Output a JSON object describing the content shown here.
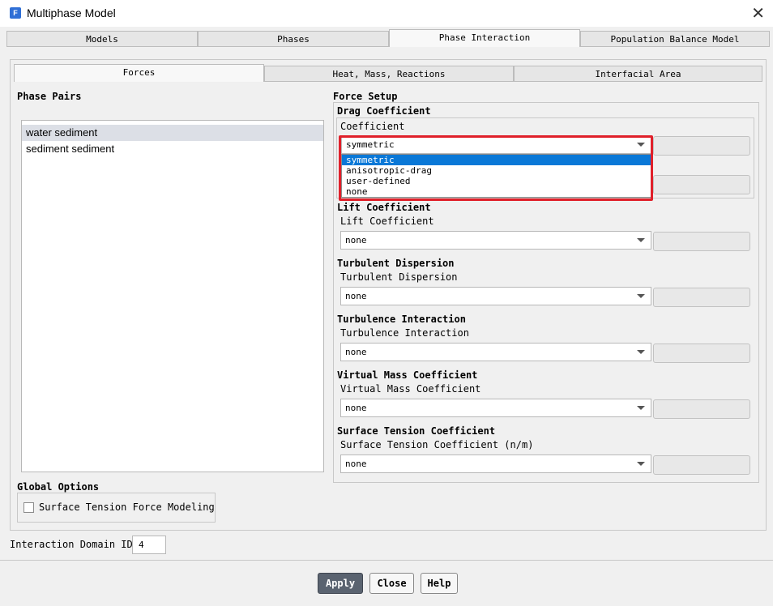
{
  "window": {
    "title": "Multiphase Model",
    "app_icon_letter": "F"
  },
  "top_tabs": [
    {
      "label": "Models"
    },
    {
      "label": "Phases"
    },
    {
      "label": "Phase Interaction"
    },
    {
      "label": "Population Balance Model"
    }
  ],
  "sub_tabs": [
    {
      "label": "Forces"
    },
    {
      "label": "Heat, Mass, Reactions"
    },
    {
      "label": "Interfacial Area"
    }
  ],
  "phase_pairs": {
    "title": "Phase Pairs",
    "items": [
      "water sediment",
      "sediment sediment"
    ],
    "selected": "water sediment"
  },
  "force_setup": {
    "title": "Force Setup",
    "drag": {
      "title": "Drag Coefficient",
      "label": "Coefficient",
      "value": "symmetric",
      "options": [
        "symmetric",
        "anisotropic-drag",
        "user-defined",
        "none"
      ],
      "highlighted": "symmetric"
    },
    "lift": {
      "title": "Lift Coefficient",
      "label": "Lift Coefficient",
      "value": "none"
    },
    "turbulent_dispersion": {
      "title": "Turbulent Dispersion",
      "label": "Turbulent Dispersion",
      "value": "none"
    },
    "turbulence_interaction": {
      "title": "Turbulence Interaction",
      "label": "Turbulence Interaction",
      "value": "none"
    },
    "virtual_mass": {
      "title": "Virtual Mass Coefficient",
      "label": "Virtual Mass Coefficient",
      "value": "none"
    },
    "surface_tension": {
      "title": "Surface Tension Coefficient",
      "label": "Surface Tension Coefficient (n/m)",
      "value": "none"
    }
  },
  "global_options": {
    "title": "Global Options",
    "surface_tension_force_label": "Surface Tension Force Modeling",
    "surface_tension_force_checked": false
  },
  "interaction_domain": {
    "label": "Interaction Domain ID",
    "value": "4"
  },
  "buttons": {
    "apply": "Apply",
    "close": "Close",
    "help": "Help"
  },
  "colors": {
    "highlight": "#0a78d7",
    "annotation_red": "#e0202a",
    "primary_button": "#5a6370"
  }
}
